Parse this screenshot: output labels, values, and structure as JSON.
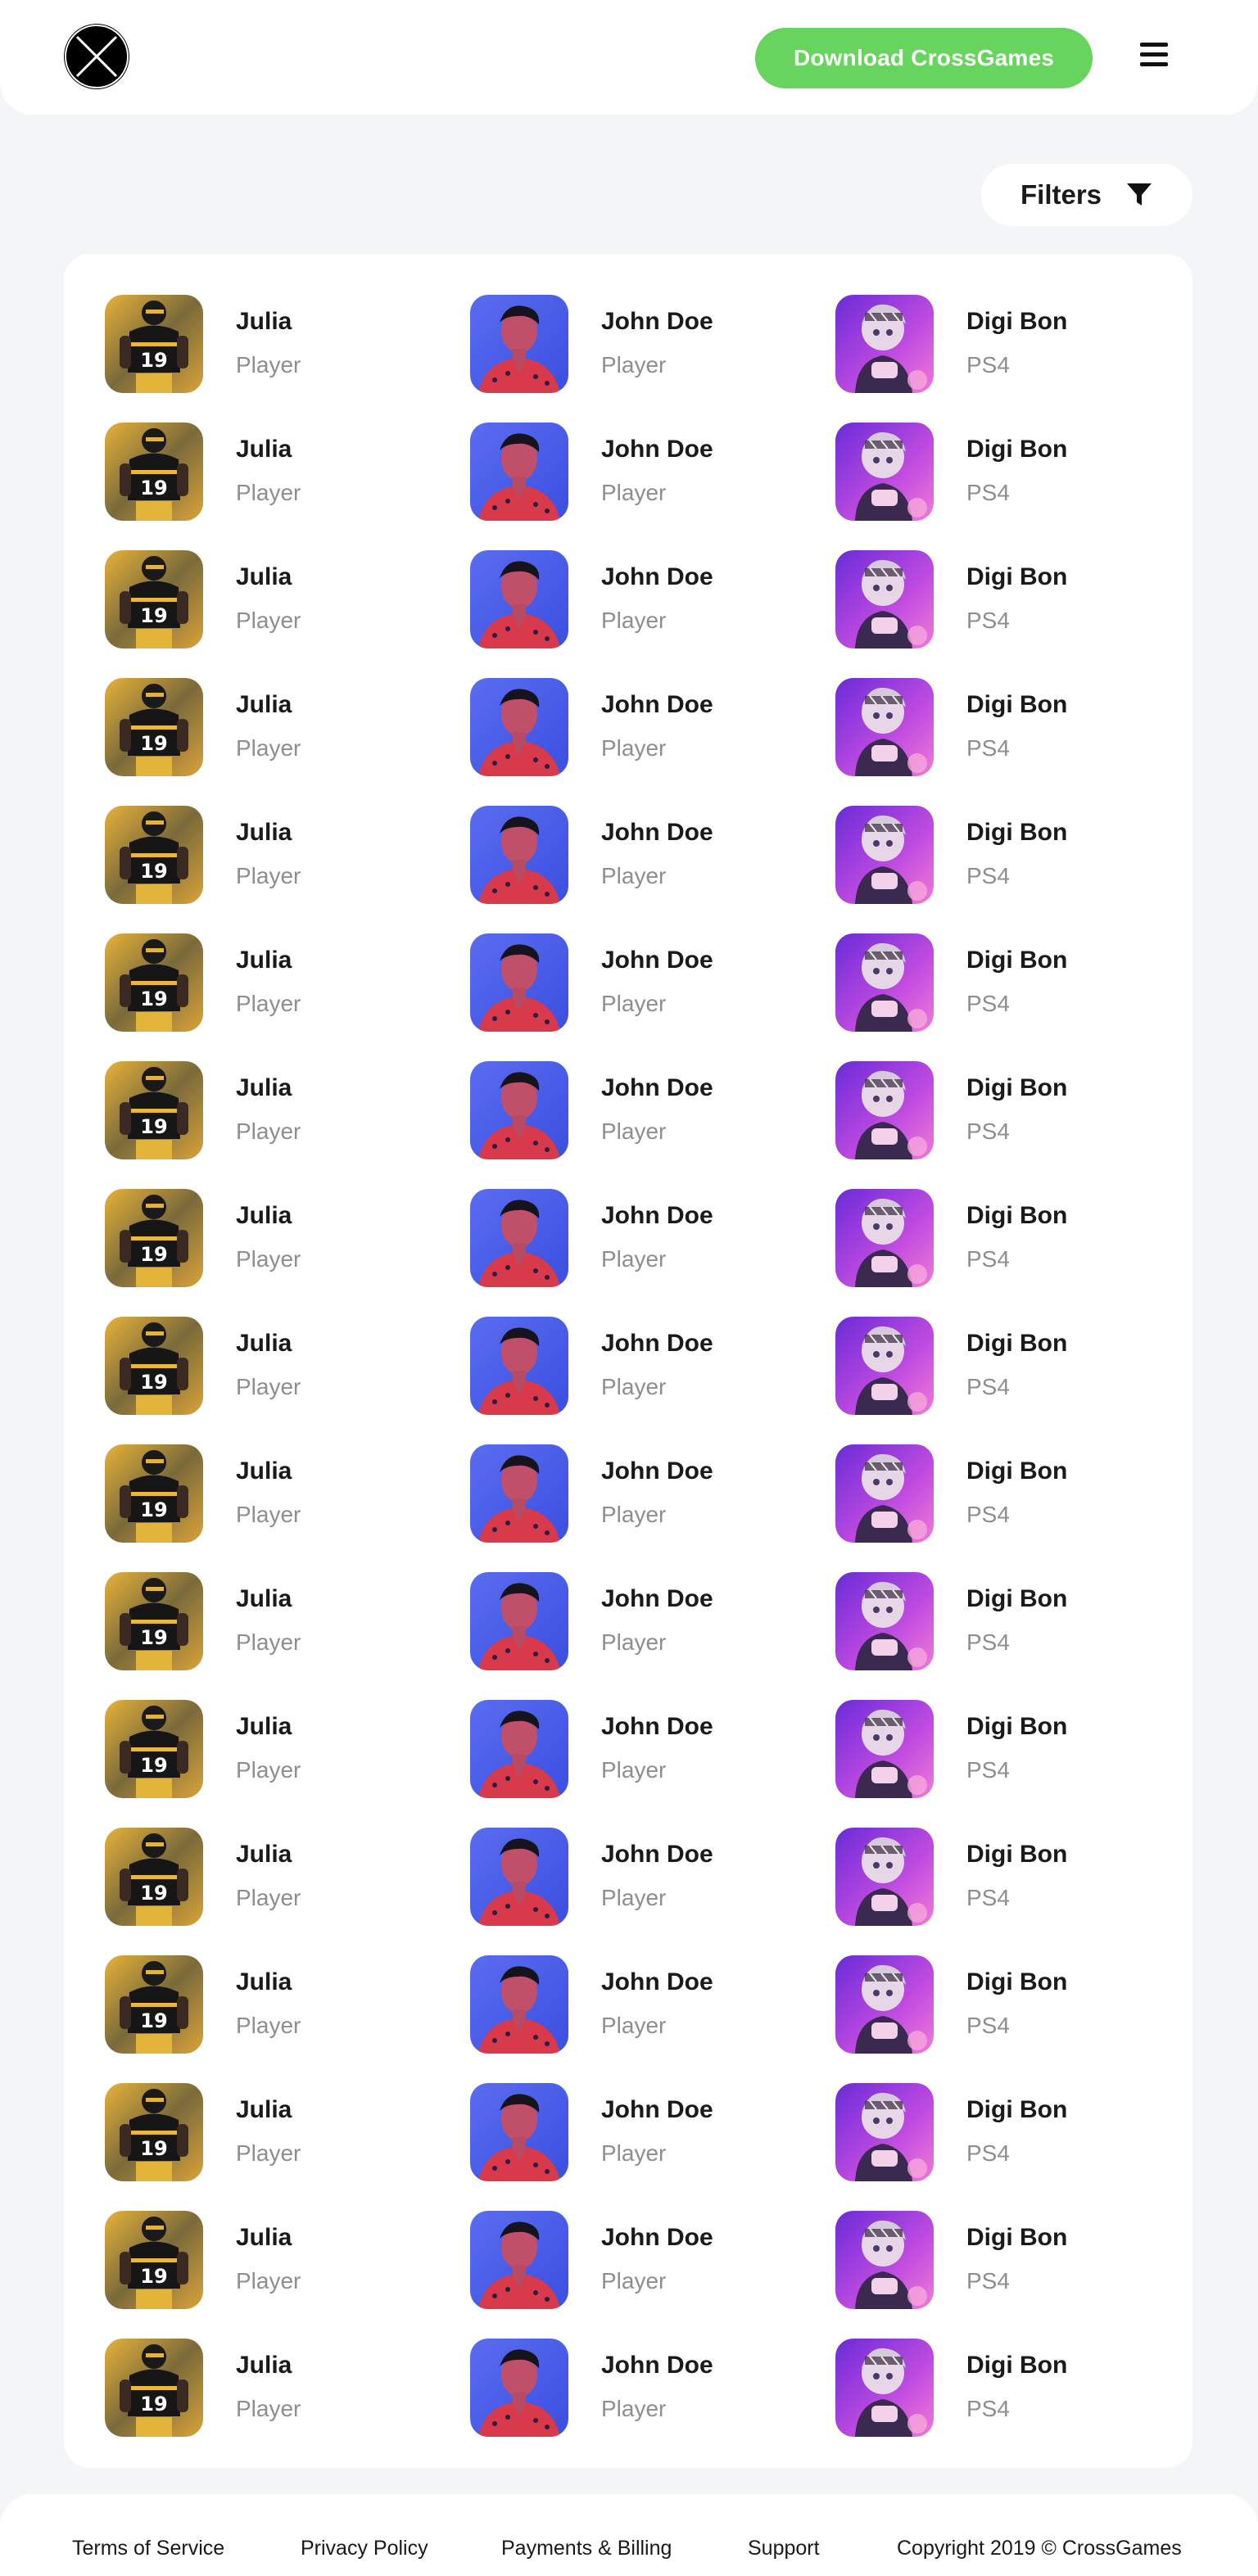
{
  "header": {
    "logo": "crossgames-x-logo",
    "download_label": "Download CrossGames",
    "menu_icon": "hamburger-menu-icon",
    "accent_color": "#66d45d"
  },
  "filters": {
    "label": "Filters",
    "icon": "funnel-icon"
  },
  "columns": [
    {
      "name": "Julia",
      "subtitle": "Player",
      "avatar": "football-player-avatar"
    },
    {
      "name": "John Doe",
      "subtitle": "Player",
      "avatar": "man-portrait-avatar"
    },
    {
      "name": "Digi Bon",
      "subtitle": "PS4",
      "avatar": "anime-character-avatar"
    }
  ],
  "rows": [
    [
      {
        "name": "Julia",
        "subtitle": "Player"
      },
      {
        "name": "John Doe",
        "subtitle": "Player"
      },
      {
        "name": "Digi Bon",
        "subtitle": "PS4"
      }
    ],
    [
      {
        "name": "Julia",
        "subtitle": "Player"
      },
      {
        "name": "John Doe",
        "subtitle": "Player"
      },
      {
        "name": "Digi Bon",
        "subtitle": "PS4"
      }
    ],
    [
      {
        "name": "Julia",
        "subtitle": "Player"
      },
      {
        "name": "John Doe",
        "subtitle": "Player"
      },
      {
        "name": "Digi Bon",
        "subtitle": "PS4"
      }
    ],
    [
      {
        "name": "Julia",
        "subtitle": "Player"
      },
      {
        "name": "John Doe",
        "subtitle": "Player"
      },
      {
        "name": "Digi Bon",
        "subtitle": "PS4"
      }
    ],
    [
      {
        "name": "Julia",
        "subtitle": "Player"
      },
      {
        "name": "John Doe",
        "subtitle": "Player"
      },
      {
        "name": "Digi Bon",
        "subtitle": "PS4"
      }
    ],
    [
      {
        "name": "Julia",
        "subtitle": "Player"
      },
      {
        "name": "John Doe",
        "subtitle": "Player"
      },
      {
        "name": "Digi Bon",
        "subtitle": "PS4"
      }
    ],
    [
      {
        "name": "Julia",
        "subtitle": "Player"
      },
      {
        "name": "John Doe",
        "subtitle": "Player"
      },
      {
        "name": "Digi Bon",
        "subtitle": "PS4"
      }
    ],
    [
      {
        "name": "Julia",
        "subtitle": "Player"
      },
      {
        "name": "John Doe",
        "subtitle": "Player"
      },
      {
        "name": "Digi Bon",
        "subtitle": "PS4"
      }
    ],
    [
      {
        "name": "Julia",
        "subtitle": "Player"
      },
      {
        "name": "John Doe",
        "subtitle": "Player"
      },
      {
        "name": "Digi Bon",
        "subtitle": "PS4"
      }
    ],
    [
      {
        "name": "Julia",
        "subtitle": "Player"
      },
      {
        "name": "John Doe",
        "subtitle": "Player"
      },
      {
        "name": "Digi Bon",
        "subtitle": "PS4"
      }
    ],
    [
      {
        "name": "Julia",
        "subtitle": "Player"
      },
      {
        "name": "John Doe",
        "subtitle": "Player"
      },
      {
        "name": "Digi Bon",
        "subtitle": "PS4"
      }
    ],
    [
      {
        "name": "Julia",
        "subtitle": "Player"
      },
      {
        "name": "John Doe",
        "subtitle": "Player"
      },
      {
        "name": "Digi Bon",
        "subtitle": "PS4"
      }
    ],
    [
      {
        "name": "Julia",
        "subtitle": "Player"
      },
      {
        "name": "John Doe",
        "subtitle": "Player"
      },
      {
        "name": "Digi Bon",
        "subtitle": "PS4"
      }
    ],
    [
      {
        "name": "Julia",
        "subtitle": "Player"
      },
      {
        "name": "John Doe",
        "subtitle": "Player"
      },
      {
        "name": "Digi Bon",
        "subtitle": "PS4"
      }
    ],
    [
      {
        "name": "Julia",
        "subtitle": "Player"
      },
      {
        "name": "John Doe",
        "subtitle": "Player"
      },
      {
        "name": "Digi Bon",
        "subtitle": "PS4"
      }
    ],
    [
      {
        "name": "Julia",
        "subtitle": "Player"
      },
      {
        "name": "John Doe",
        "subtitle": "Player"
      },
      {
        "name": "Digi Bon",
        "subtitle": "PS4"
      }
    ],
    [
      {
        "name": "Julia",
        "subtitle": "Player"
      },
      {
        "name": "John Doe",
        "subtitle": "Player"
      },
      {
        "name": "Digi Bon",
        "subtitle": "PS4"
      }
    ]
  ],
  "footer": {
    "terms": "Terms of Service",
    "privacy": "Privacy Policy",
    "payments": "Payments & Billing",
    "support": "Support",
    "copyright": "Copyright 2019 © CrossGames"
  }
}
